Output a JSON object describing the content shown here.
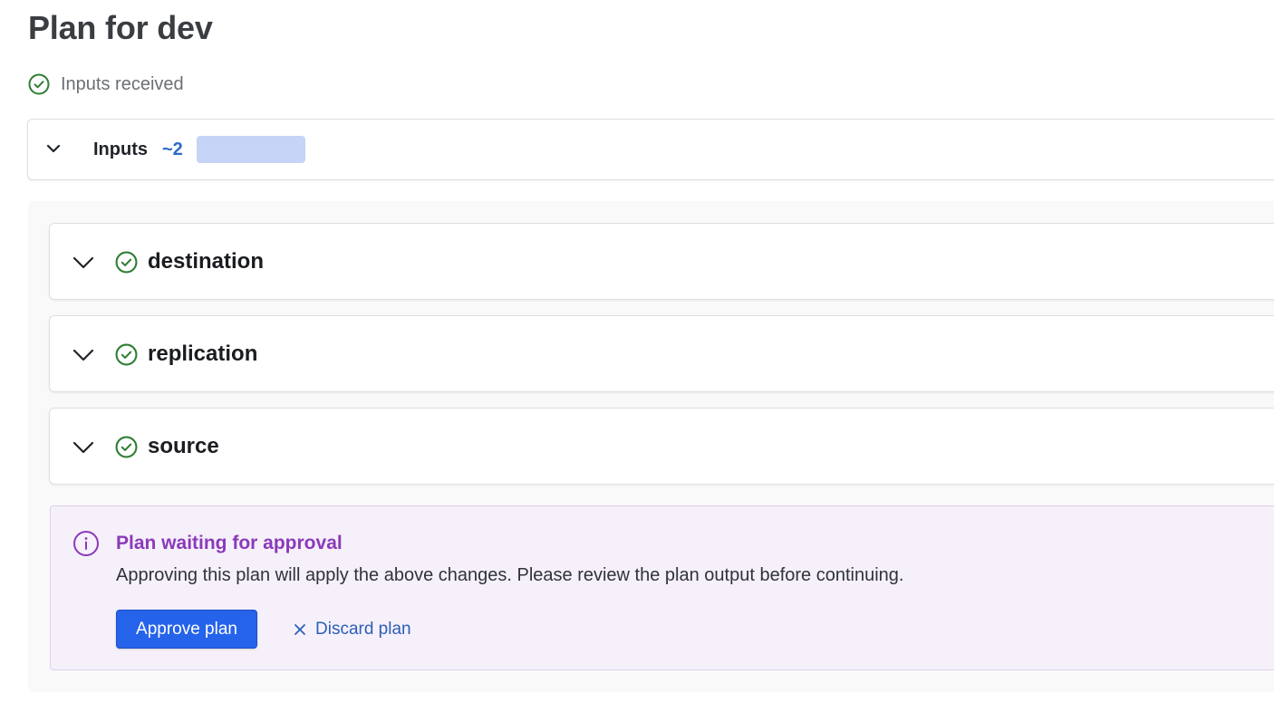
{
  "page": {
    "title": "Plan for dev"
  },
  "status": {
    "text": "Inputs received",
    "icon": "check-circle-icon",
    "color": "#2e7d32"
  },
  "inputs": {
    "label": "Inputs",
    "count": "~2"
  },
  "modules": [
    {
      "name": "destination",
      "status_icon": "check-circle-icon"
    },
    {
      "name": "replication",
      "status_icon": "check-circle-icon"
    },
    {
      "name": "source",
      "status_icon": "check-circle-icon"
    }
  ],
  "approval": {
    "icon": "info-icon",
    "title": "Plan waiting for approval",
    "body": "Approving this plan will apply the above changes. Please review the plan output before continuing.",
    "approve_label": "Approve plan",
    "discard_label": "Discard plan",
    "accent": "#8a3ab9",
    "button_color": "#2563eb"
  }
}
